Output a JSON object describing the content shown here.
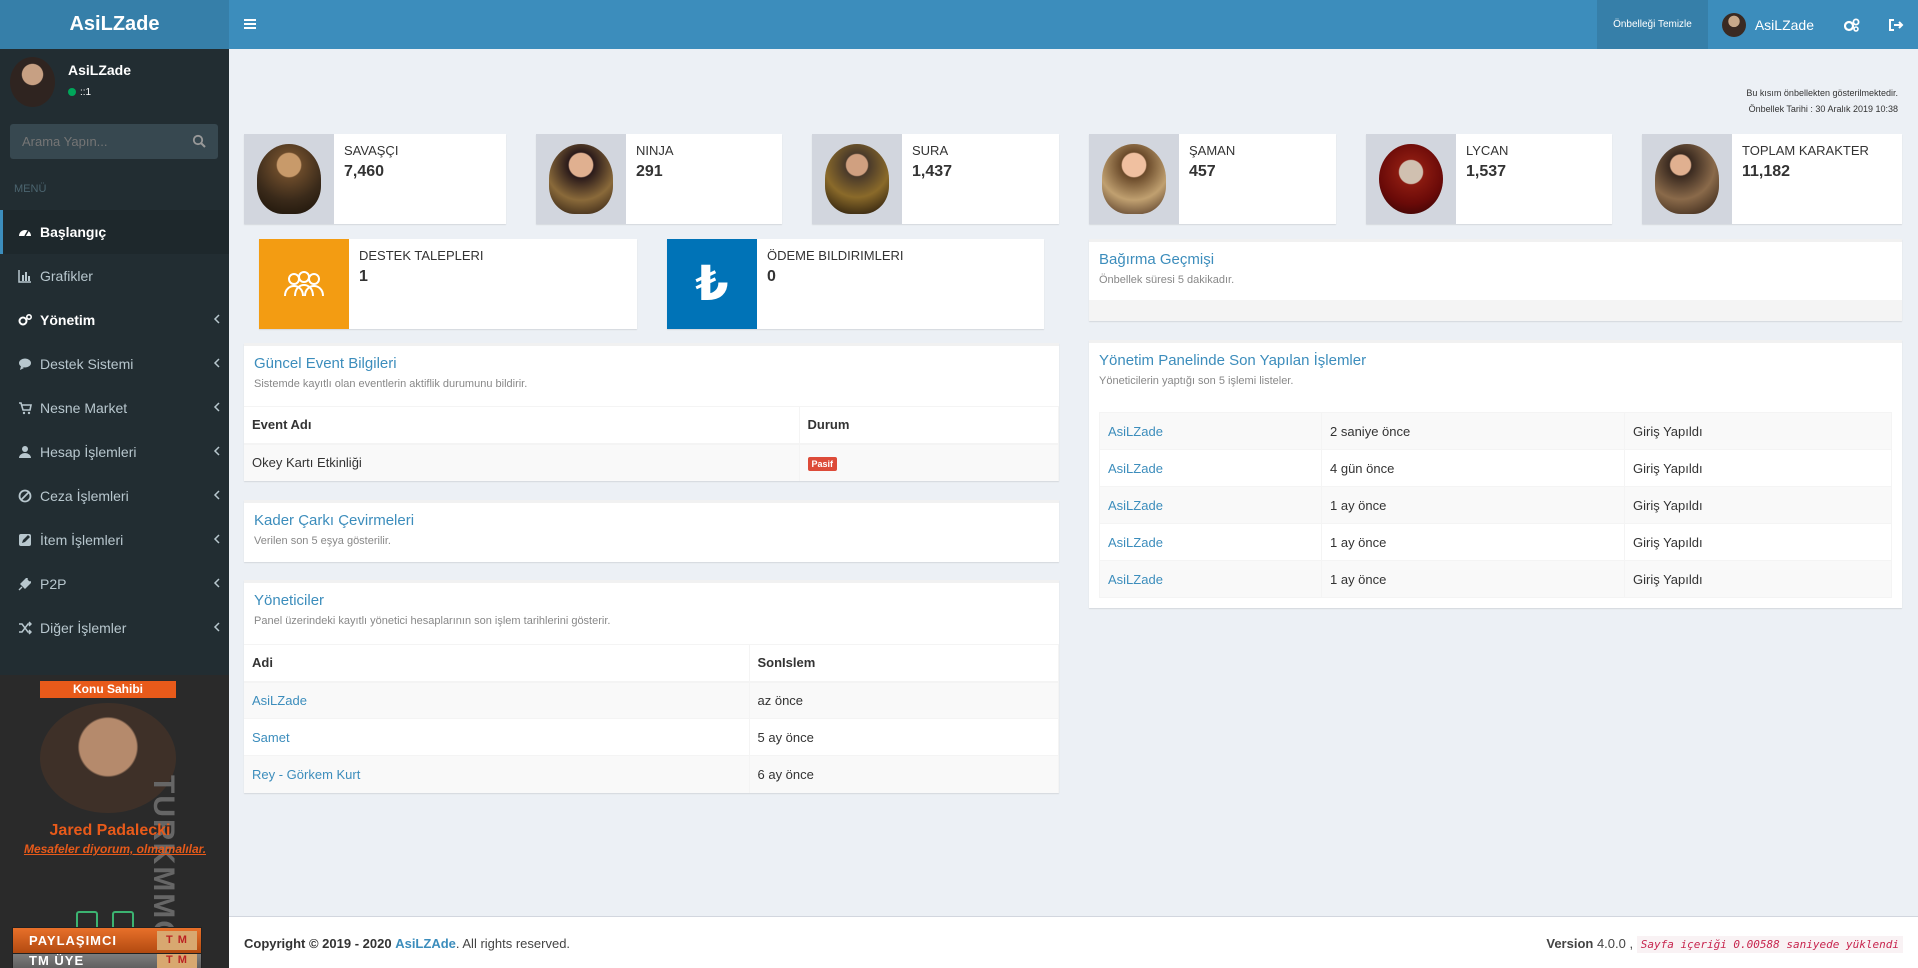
{
  "header": {
    "logo": "AsiLZade",
    "cache_button": "Önbelleği Temizle",
    "user_name": "AsiLZade"
  },
  "sidebar": {
    "user_name": "AsiLZade",
    "user_status": "::1",
    "search_placeholder": "Arama Yapın...",
    "menu_header": "MENÜ",
    "items": [
      {
        "label": "Başlangıç"
      },
      {
        "label": "Grafikler"
      },
      {
        "label": "Yönetim"
      },
      {
        "label": "Destek Sistemi"
      },
      {
        "label": "Nesne Market"
      },
      {
        "label": "Hesap İşlemleri"
      },
      {
        "label": "Ceza İşlemleri"
      },
      {
        "label": "İtem İşlemleri"
      },
      {
        "label": "P2P"
      },
      {
        "label": "Diğer İşlemler"
      }
    ],
    "banner": {
      "title": "Konu Sahibi",
      "brand": "TURKMMO",
      "name": "Jared Padalecki",
      "quote": "Mesafeler diyorum, olmamalılar.",
      "badge1": "TM ÜYE",
      "badge2": "PAYLAŞIMCI",
      "badge_tag": "T M"
    }
  },
  "cache_note": {
    "line1": "Bu kısım önbellekten gösterilmektedir.",
    "line2": "Önbellek Tarihi : 30 Aralık 2019 10:38"
  },
  "stats": [
    {
      "label": "SAVAŞÇI",
      "value": "7,460"
    },
    {
      "label": "NINJA",
      "value": "291"
    },
    {
      "label": "SURA",
      "value": "1,437"
    },
    {
      "label": "ŞAMAN",
      "value": "457"
    },
    {
      "label": "LYCAN",
      "value": "1,537"
    },
    {
      "label": "TOPLAM KARAKTER",
      "value": "11,182"
    }
  ],
  "support": {
    "label": "DESTEK TALEPLERI",
    "value": "1"
  },
  "payment": {
    "label": "ÖDEME BILDIRIMLERI",
    "value": "0",
    "glyph": "₺"
  },
  "events": {
    "title": "Güncel Event Bilgileri",
    "subtitle": "Sistemde kayıtlı olan eventlerin aktiflik durumunu bildirir.",
    "col1": "Event Adı",
    "col2": "Durum",
    "rows": [
      {
        "name": "Okey Kartı Etkinliği",
        "status": "Pasif"
      }
    ]
  },
  "wheel": {
    "title": "Kader Çarkı Çevirmeleri",
    "subtitle": "Verilen son 5 eşya gösterilir."
  },
  "admins": {
    "title": "Yöneticiler",
    "subtitle": "Panel üzerindeki kayıtlı yönetici hesaplarının son işlem tarihlerini gösterir.",
    "col1": "Adi",
    "col2": "SonIslem",
    "rows": [
      {
        "name": "AsiLZade",
        "last": "az önce"
      },
      {
        "name": "Samet",
        "last": "5 ay önce"
      },
      {
        "name": "Rey - Görkem Kurt",
        "last": "6 ay önce"
      }
    ]
  },
  "shout": {
    "title": "Bağırma Geçmişi",
    "subtitle": "Önbellek süresi 5 dakikadır."
  },
  "recent": {
    "title": "Yönetim Panelinde Son Yapılan İşlemler",
    "subtitle": "Yöneticilerin yaptığı son 5 işlemi listeler.",
    "rows": [
      {
        "user": "AsiLZade",
        "time": "2 saniye önce",
        "action": "Giriş Yapıldı"
      },
      {
        "user": "AsiLZade",
        "time": "4 gün önce",
        "action": "Giriş Yapıldı"
      },
      {
        "user": "AsiLZade",
        "time": "1 ay önce",
        "action": "Giriş Yapıldı"
      },
      {
        "user": "AsiLZade",
        "time": "1 ay önce",
        "action": "Giriş Yapıldı"
      },
      {
        "user": "AsiLZade",
        "time": "1 ay önce",
        "action": "Giriş Yapıldı"
      }
    ]
  },
  "footer": {
    "copyright": "Copyright © 2019 - 2020",
    "brand": "AsiLZAde",
    "rights": ". All rights reserved.",
    "version_label": "Version",
    "version": "4.0.0 ,",
    "load_time": "Sayfa içeriği 0.00588 saniyede yüklendi"
  },
  "colors": {
    "header": "#3c8dbc",
    "sidebar": "#222d32",
    "support_box": "#f39c12",
    "payment_box": "#0073b7",
    "pasif_badge": "#dd4b39"
  }
}
